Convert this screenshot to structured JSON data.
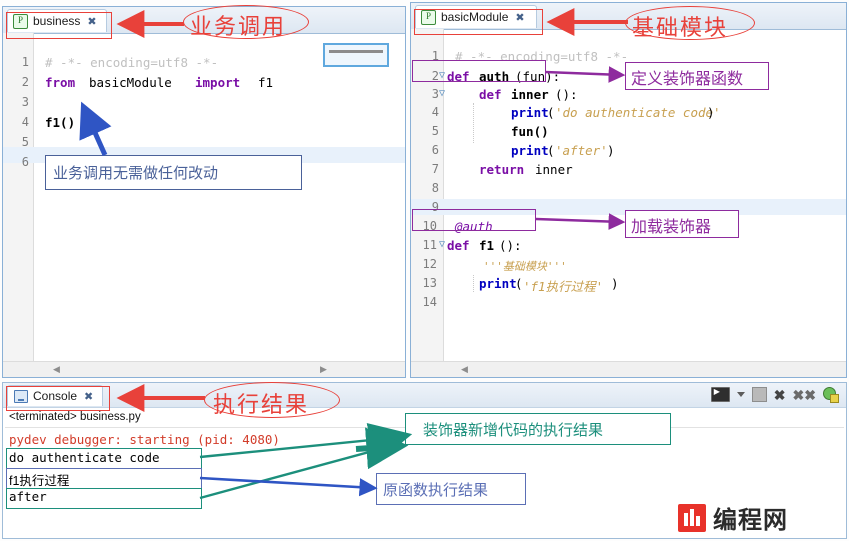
{
  "editor_left": {
    "tab": {
      "label": "business",
      "icon": "python-file-icon",
      "close": "✖"
    },
    "lines": [
      {
        "n": "1",
        "text": "# -*- encoding=utf8 -*-"
      },
      {
        "n": "2",
        "text": "from basicModule import f1"
      },
      {
        "n": "3",
        "text": ""
      },
      {
        "n": "4",
        "text": "f1()"
      },
      {
        "n": "5",
        "text": ""
      },
      {
        "n": "6",
        "text": ""
      }
    ],
    "tokens": {
      "l1_comment": "# -*- encoding=utf8 -*-",
      "l2_kw_from": "from",
      "l2_module": "basicModule",
      "l2_kw_import": "import",
      "l2_name": "f1",
      "l4_call": "f1()"
    },
    "scroll_left_arrow": "◀",
    "scroll_right_arrow": "▶"
  },
  "editor_right": {
    "tab": {
      "label": "basicModule",
      "icon": "python-file-icon",
      "close": "✖"
    },
    "lines": [
      {
        "n": "1",
        "text": "# -*- encoding=utf8 -*-"
      },
      {
        "n": "2",
        "text": "def auth(fun):"
      },
      {
        "n": "3",
        "text": "    def inner():"
      },
      {
        "n": "4",
        "text": "        print('do authenticate code')"
      },
      {
        "n": "5",
        "text": "        fun()"
      },
      {
        "n": "6",
        "text": "        print('after')"
      },
      {
        "n": "7",
        "text": "    return inner"
      },
      {
        "n": "8",
        "text": ""
      },
      {
        "n": "9",
        "text": ""
      },
      {
        "n": "10",
        "text": "@auth"
      },
      {
        "n": "11",
        "text": "def f1():"
      },
      {
        "n": "12",
        "text": "    '''基础模块'''"
      },
      {
        "n": "13",
        "text": "    print('f1执行过程')"
      },
      {
        "n": "14",
        "text": ""
      }
    ],
    "tokens": {
      "comment": "# -*- encoding=utf8 -*-",
      "kw_def": "def",
      "kw_return": "return",
      "fn_auth": "auth",
      "arg_fun": "(fun):",
      "fn_inner": "inner",
      "inner_paren": "():",
      "print": "print",
      "str_do_auth": "'do authenticate code'",
      "str_after": "'after'",
      "call_fun": "fun()",
      "ret_inner": "inner",
      "decorator": "@auth",
      "fn_f1": "f1",
      "f1_paren": "():",
      "docstring": "'''基础模块'''",
      "str_f1": "'f1执行过程'"
    },
    "scroll_left_arrow": "◀"
  },
  "console": {
    "tab": {
      "label": "Console",
      "icon": "console-icon",
      "close": "✖"
    },
    "terminated": "<terminated> business.py",
    "output": [
      {
        "text": "pydev debugger: starting (pid: 4080)",
        "color": "#d23c2a"
      },
      {
        "text": "do authenticate code",
        "color": "#000000"
      },
      {
        "text": "f1执行过程",
        "color": "#000000"
      },
      {
        "text": "after",
        "color": "#000000"
      }
    ],
    "toolbar": [
      {
        "name": "display-selected-console-icon"
      },
      {
        "name": "chevron-down-icon"
      },
      {
        "name": "stop-icon"
      },
      {
        "name": "remove-launch-icon"
      },
      {
        "name": "remove-all-terminated-icon"
      },
      {
        "name": "pin-console-icon"
      }
    ]
  },
  "annotations": {
    "business_call": "业务调用",
    "basic_module": "基础模块",
    "exec_result": "执行结果",
    "no_change_needed": "业务调用无需做任何改动",
    "define_decorator_fn": "定义装饰器函数",
    "load_decorator": "加载装饰器",
    "decorator_added_code_result": "装饰器新增代码的执行结果",
    "original_fn_result": "原函数执行结果"
  },
  "watermark": {
    "text": "编程网"
  },
  "colors": {
    "red": "#e8413a",
    "purple": "#8e2b9e",
    "teal": "#1c8f7c",
    "blue": "#5b6fb5",
    "navy": "#4a6199",
    "keyword": "#7a0fa6",
    "string": "#c8a050",
    "comment": "#c0c0c0",
    "console_error": "#d23c2a"
  }
}
